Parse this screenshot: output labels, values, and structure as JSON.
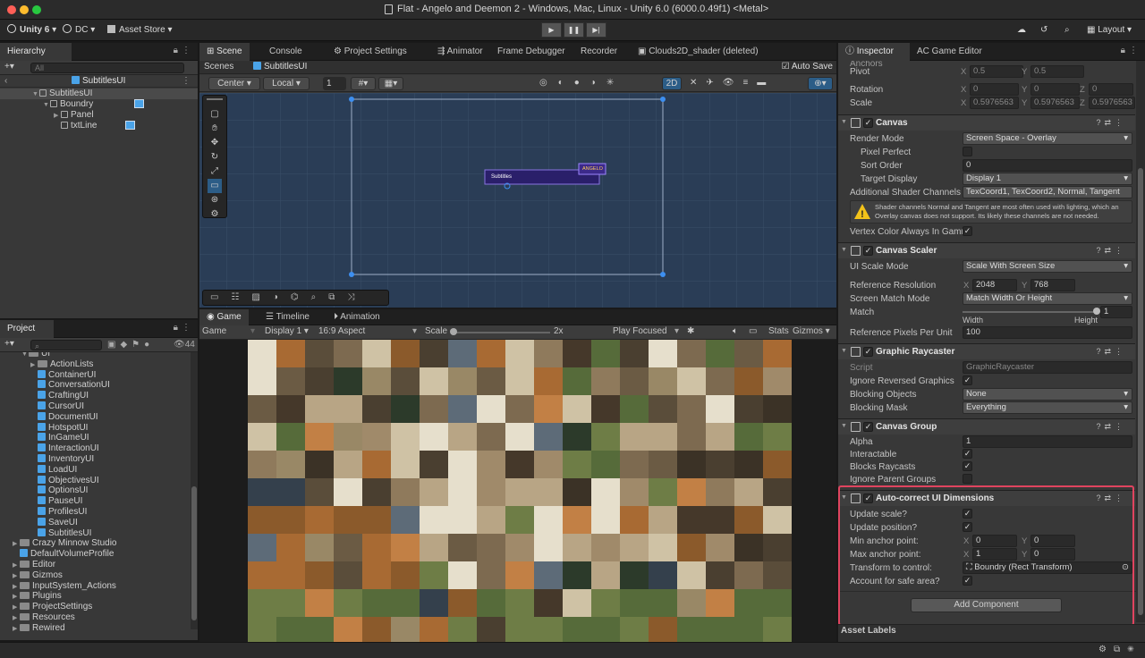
{
  "window": {
    "title": "Flat - Angelo and Deemon 2 - Windows, Mac, Linux - Unity 6.0 (6000.0.49f1) <Metal>"
  },
  "toolbar": {
    "unity": "Unity 6",
    "account": "DC",
    "asset_store": "Asset Store",
    "layout": "Layout"
  },
  "hierarchy": {
    "tab": "Hierarchy",
    "search_placeholder": "All",
    "scene": "SubtitlesUI",
    "items": [
      {
        "label": "SubtitlesUI",
        "indent": 0
      },
      {
        "label": "Boundry",
        "indent": 1
      },
      {
        "label": "Panel",
        "indent": 2
      },
      {
        "label": "txtLine",
        "indent": 2
      }
    ]
  },
  "project": {
    "tab": "Project",
    "count": "44",
    "folders": [
      "UI",
      "ActionLists"
    ],
    "ui_assets": [
      "ContainerUI",
      "ConversationUI",
      "CraftingUI",
      "CursorUI",
      "DocumentUI",
      "HotspotUI",
      "InGameUI",
      "InteractionUI",
      "InventoryUI",
      "LoadUI",
      "ObjectivesUI",
      "OptionsUI",
      "PauseUI",
      "ProfilesUI",
      "SaveUI",
      "SubtitlesUI"
    ],
    "root_items": [
      "Crazy Minnow Studio",
      "DefaultVolumeProfile",
      "Editor",
      "Gizmos",
      "InputSystem_Actions",
      "Plugins",
      "ProjectSettings",
      "Resources",
      "Rewired"
    ]
  },
  "scene_tabs": [
    "Scene",
    "Console",
    "Project Settings",
    "Animator",
    "Frame Debugger",
    "Recorder",
    "Clouds2D_shader (deleted)"
  ],
  "scene": {
    "breadcrumb_scenes": "Scenes",
    "breadcrumb_item": "SubtitlesUI",
    "auto_save": "Auto Save",
    "pivot_mode": "Center",
    "space": "Local",
    "grid_value": "1",
    "mode_2d": "2D",
    "subtitle_text": "Subtitles",
    "speaker_tag": "ANGELO"
  },
  "game_tabs": [
    "Game",
    "Timeline",
    "Animation"
  ],
  "game": {
    "view": "Game",
    "display": "Display 1",
    "aspect": "16:9 Aspect",
    "scale_label": "Scale",
    "scale_value": "2x",
    "play_mode": "Play Focused",
    "stats": "Stats",
    "gizmos": "Gizmos",
    "scale_fraction": 0.0
  },
  "inspector": {
    "tabs": [
      "Inspector",
      "AC Game Editor"
    ],
    "anchors": "Anchors",
    "pivot": {
      "label": "Pivot",
      "x": "0.5",
      "y": "0.5"
    },
    "rotation": {
      "label": "Rotation",
      "x": "0",
      "y": "0",
      "z": "0"
    },
    "scale": {
      "label": "Scale",
      "x": "0.5976563",
      "y": "0.5976563",
      "z": "0.5976563"
    },
    "canvas": {
      "title": "Canvas",
      "render_mode": {
        "label": "Render Mode",
        "value": "Screen Space - Overlay"
      },
      "pixel_perfect": "Pixel Perfect",
      "sort_order": {
        "label": "Sort Order",
        "value": "0"
      },
      "target_display": {
        "label": "Target Display",
        "value": "Display 1"
      },
      "shader_channels": {
        "label": "Additional Shader Channels",
        "value": "TexCoord1, TexCoord2, Normal, Tangent"
      },
      "warning": "Shader channels Normal and Tangent are most often used with lighting, which an Overlay canvas does not support. Its likely these channels are not needed.",
      "vertex_color": "Vertex Color Always In Gamm"
    },
    "scaler": {
      "title": "Canvas Scaler",
      "mode": {
        "label": "UI Scale Mode",
        "value": "Scale With Screen Size"
      },
      "ref_res": {
        "label": "Reference Resolution",
        "x": "2048",
        "y": "768"
      },
      "match_mode": {
        "label": "Screen Match Mode",
        "value": "Match Width Or Height"
      },
      "match": {
        "label": "Match",
        "value": "1",
        "left": "Width",
        "right": "Height",
        "fraction": 1.0
      },
      "ppu": {
        "label": "Reference Pixels Per Unit",
        "value": "100"
      }
    },
    "raycaster": {
      "title": "Graphic Raycaster",
      "script": {
        "label": "Script",
        "value": "GraphicRaycaster"
      },
      "ignore_reversed": "Ignore Reversed Graphics",
      "blocking_objects": {
        "label": "Blocking Objects",
        "value": "None"
      },
      "blocking_mask": {
        "label": "Blocking Mask",
        "value": "Everything"
      }
    },
    "group": {
      "title": "Canvas Group",
      "alpha": {
        "label": "Alpha",
        "value": "1"
      },
      "interactable": "Interactable",
      "blocks": "Blocks Raycasts",
      "ignore_parent": "Ignore Parent Groups"
    },
    "autocorrect": {
      "title": "Auto-correct UI Dimensions",
      "update_scale": "Update scale?",
      "update_position": "Update position?",
      "min_anchor": {
        "label": "Min anchor point:",
        "x": "0",
        "y": "0"
      },
      "max_anchor": {
        "label": "Max anchor point:",
        "x": "1",
        "y": "0"
      },
      "transform": {
        "label": "Transform to control:",
        "value": "Boundry (Rect Transform)"
      },
      "safe_area": "Account for safe area?"
    },
    "add_component": "Add Component",
    "asset_labels": "Asset Labels"
  },
  "axes": {
    "x": "X",
    "y": "Y",
    "z": "Z"
  },
  "colors": {
    "highlight": "#e0445f",
    "accent": "#4aa3e8",
    "selected": "#2c5d87"
  }
}
